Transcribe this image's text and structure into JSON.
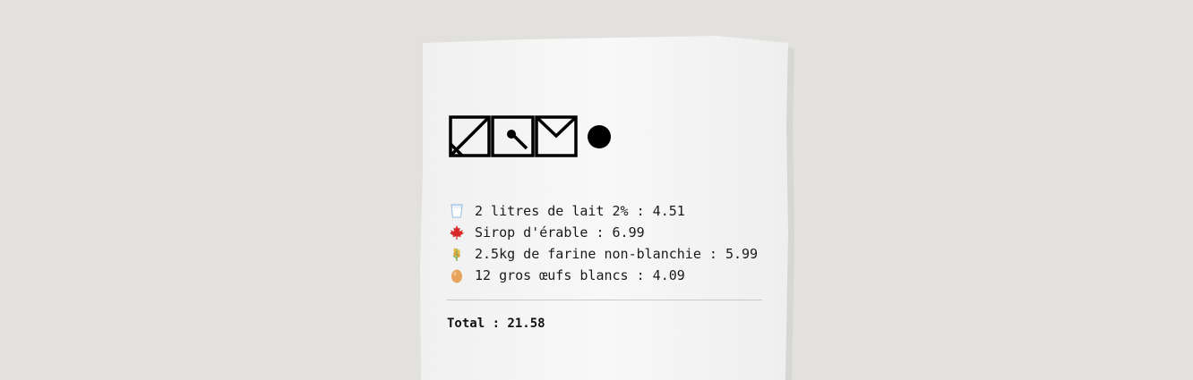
{
  "brand": {
    "logo_icon": "brand-logo-mark"
  },
  "items": [
    {
      "icon": "milk-glass-icon",
      "label": "2 litres de lait 2% : 4.51"
    },
    {
      "icon": "maple-leaf-icon",
      "label": "Sirop d'érable : 6.99"
    },
    {
      "icon": "wheat-icon",
      "label": "2.5kg de farine non-blanchie : 5.99"
    },
    {
      "icon": "egg-icon",
      "label": "12 gros œufs blancs : 4.09"
    }
  ],
  "total": {
    "label": "Total : 21.58"
  },
  "colors": {
    "background": "#e2e1de",
    "paper": "#f6f6f6",
    "text": "#1a1a1a",
    "maple": "#d62828",
    "egg": "#e8a35f",
    "milk": "#9cc3e6"
  }
}
